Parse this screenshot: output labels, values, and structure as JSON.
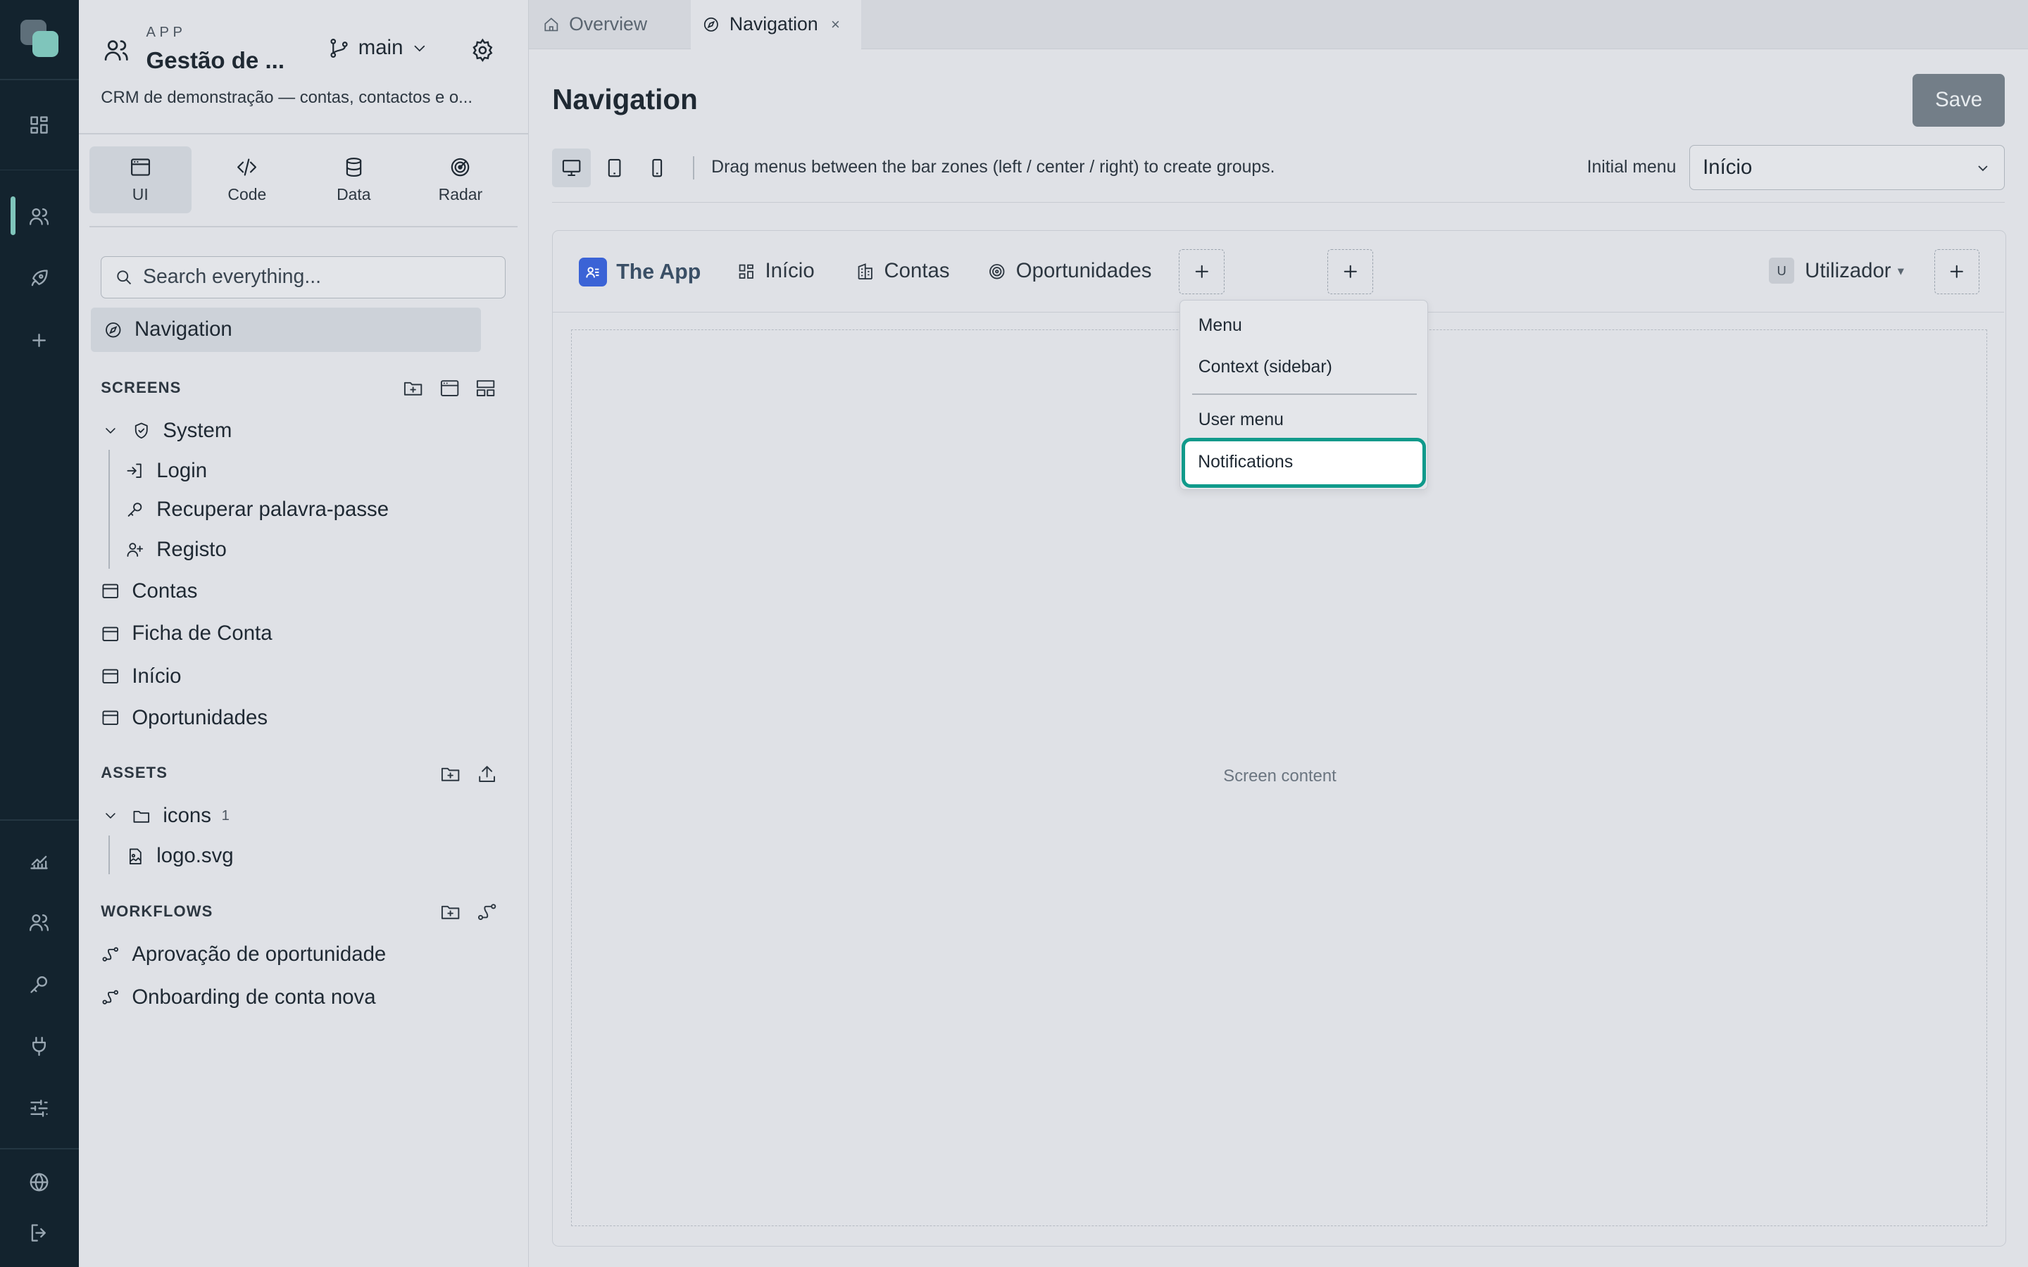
{
  "sidebar": {
    "app_kicker": "APP",
    "app_name": "Gestão de ...",
    "branch": "main",
    "description": "CRM de demonstração — contas, contactos e o...",
    "modes": [
      {
        "label": "UI",
        "icon": "window-icon",
        "active": true
      },
      {
        "label": "Code",
        "icon": "code-icon",
        "active": false
      },
      {
        "label": "Data",
        "icon": "database-icon",
        "active": false
      },
      {
        "label": "Radar",
        "icon": "radar-icon",
        "active": false
      }
    ],
    "search_placeholder": "Search everything...",
    "selected_item": "Navigation",
    "screens": {
      "title": "SCREENS",
      "system_folder": "System",
      "system_children": [
        "Login",
        "Recuperar palavra-passe",
        "Registo"
      ],
      "items": [
        "Contas",
        "Ficha de Conta",
        "Início",
        "Oportunidades"
      ]
    },
    "assets": {
      "title": "ASSETS",
      "folder": "icons",
      "folder_count": "1",
      "file": "logo.svg"
    },
    "workflows": {
      "title": "WORKFLOWS",
      "items": [
        "Aprovação de oportunidade",
        "Onboarding de conta nova"
      ]
    }
  },
  "tabs": [
    {
      "label": "Overview",
      "icon": "home-icon",
      "active": false
    },
    {
      "label": "Navigation",
      "icon": "compass-icon",
      "active": true,
      "close": "×"
    }
  ],
  "main": {
    "title": "Navigation",
    "save_label": "Save",
    "hint": "Drag menus between the bar zones (left / center / right) to create groups.",
    "initial_menu_label": "Initial menu",
    "initial_menu_value": "Início"
  },
  "preview": {
    "brand": "The App",
    "menus": [
      {
        "label": "Início",
        "icon": "grid-icon"
      },
      {
        "label": "Contas",
        "icon": "building-icon"
      },
      {
        "label": "Oportunidades",
        "icon": "target-icon"
      }
    ],
    "user_initial": "U",
    "user_label": "Utilizador",
    "content_label": "Screen content"
  },
  "dropdown": {
    "items": [
      "Menu",
      "Context (sidebar)",
      "User menu",
      "Notifications"
    ],
    "highlighted": "Notifications"
  },
  "colors": {
    "rail_bg": "#13232e",
    "accent": "#7fc5bb",
    "focus_ring": "#109a8b",
    "brand_blue": "#3b63d6",
    "save_bg": "#737e88"
  }
}
